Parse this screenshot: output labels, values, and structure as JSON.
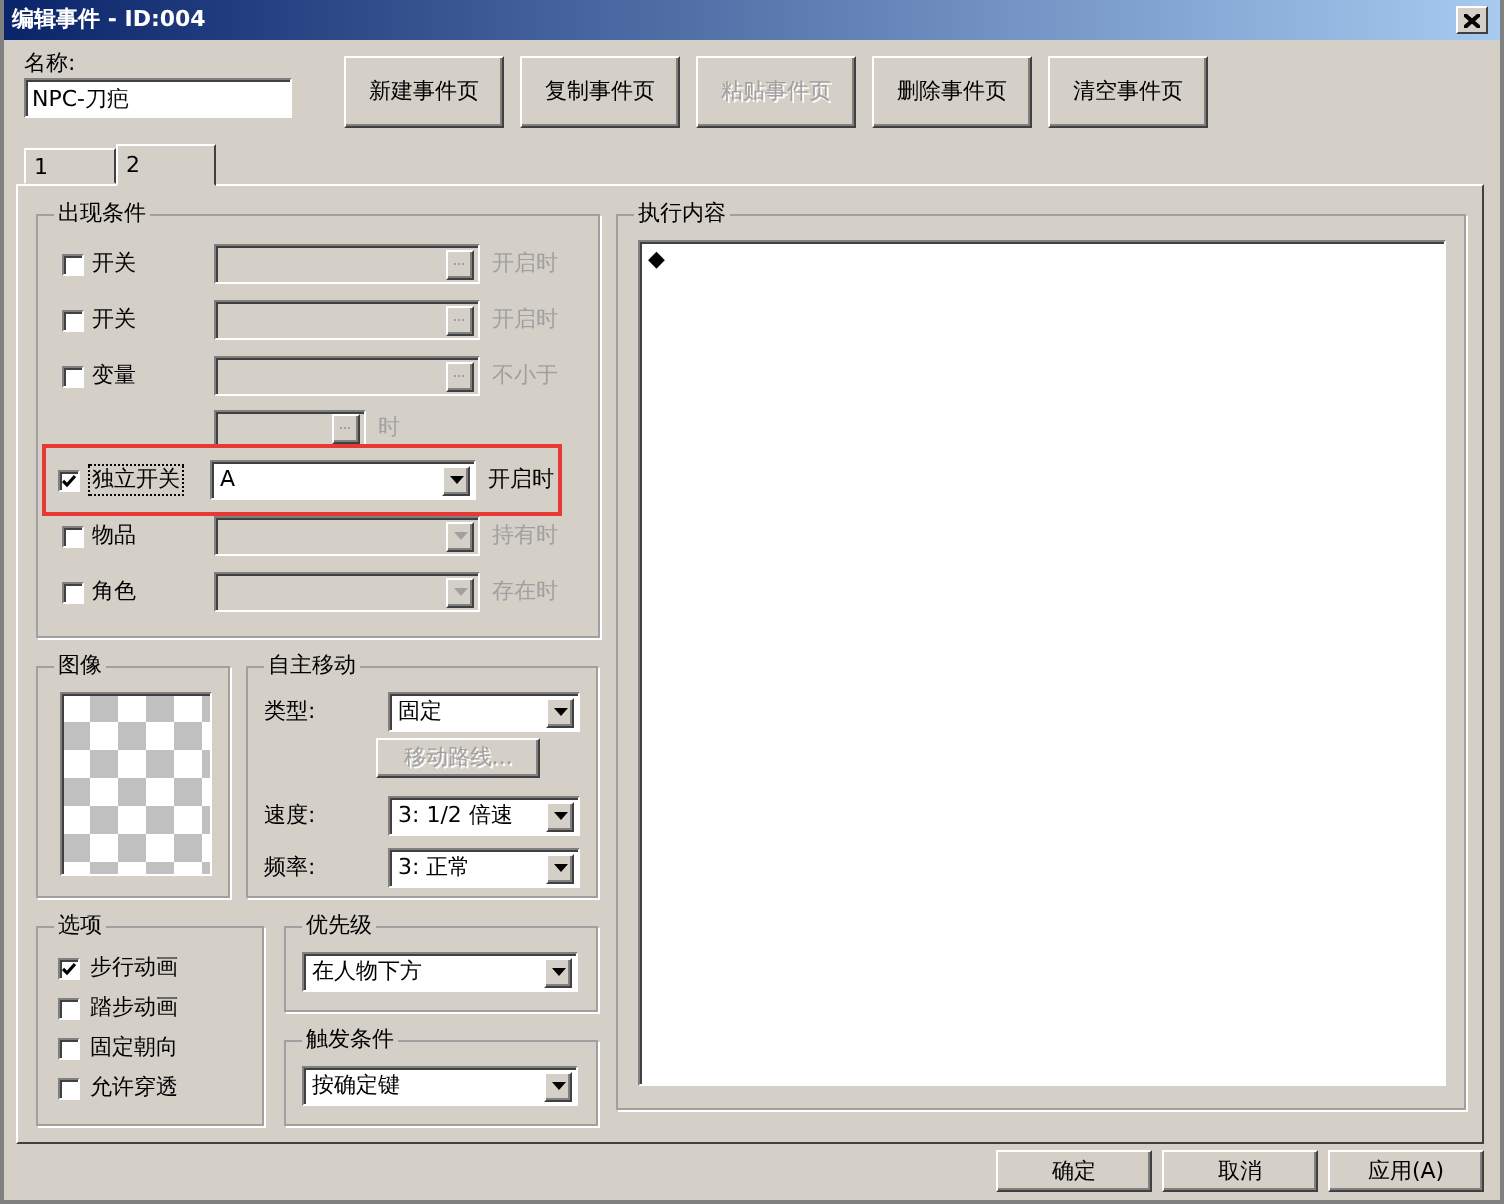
{
  "window": {
    "title": "编辑事件 - ID:004"
  },
  "name": {
    "label": "名称:",
    "value": "NPC-刀疤"
  },
  "page_buttons": [
    {
      "label": "新建事件页",
      "disabled": false
    },
    {
      "label": "复制事件页",
      "disabled": false
    },
    {
      "label": "粘贴事件页",
      "disabled": true
    },
    {
      "label": "删除事件页",
      "disabled": false
    },
    {
      "label": "清空事件页",
      "disabled": false
    }
  ],
  "tabs": [
    {
      "label": "1",
      "selected": false
    },
    {
      "label": "2",
      "selected": true
    }
  ],
  "conditions": {
    "title": "出现条件",
    "rows": [
      {
        "kind": "picker",
        "label": "开关",
        "checked": false,
        "suffix": "开启时",
        "highlighted": false
      },
      {
        "kind": "picker",
        "label": "开关",
        "checked": false,
        "suffix": "开启时",
        "highlighted": false
      },
      {
        "kind": "picker",
        "label": "变量",
        "checked": false,
        "suffix": "不小于",
        "highlighted": false
      },
      {
        "kind": "spin",
        "suffix": "时"
      },
      {
        "kind": "dropdown",
        "label": "独立开关",
        "checked": true,
        "value": "A",
        "suffix": "开启时",
        "highlighted": true
      },
      {
        "kind": "dropdown",
        "label": "物品",
        "checked": false,
        "suffix": "持有时",
        "highlighted": false
      },
      {
        "kind": "dropdown",
        "label": "角色",
        "checked": false,
        "suffix": "存在时",
        "highlighted": false
      }
    ]
  },
  "graphic": {
    "title": "图像"
  },
  "movement": {
    "title": "自主移动",
    "type": {
      "label": "类型:",
      "value": "固定"
    },
    "route_button": {
      "label": "移动路线...",
      "disabled": true
    },
    "speed": {
      "label": "速度:",
      "value": "3: 1/2 倍速"
    },
    "frequency": {
      "label": "频率:",
      "value": "3: 正常"
    }
  },
  "options": {
    "title": "选项",
    "items": [
      {
        "label": "步行动画",
        "checked": true
      },
      {
        "label": "踏步动画",
        "checked": false
      },
      {
        "label": "固定朝向",
        "checked": false
      },
      {
        "label": "允许穿透",
        "checked": false
      }
    ]
  },
  "priority": {
    "title": "优先级",
    "value": "在人物下方"
  },
  "trigger": {
    "title": "触发条件",
    "value": "按确定键"
  },
  "commands": {
    "title": "执行内容",
    "items": [
      "◆"
    ]
  },
  "footer_buttons": [
    {
      "label": "确定"
    },
    {
      "label": "取消"
    },
    {
      "label": "应用(A)"
    }
  ]
}
